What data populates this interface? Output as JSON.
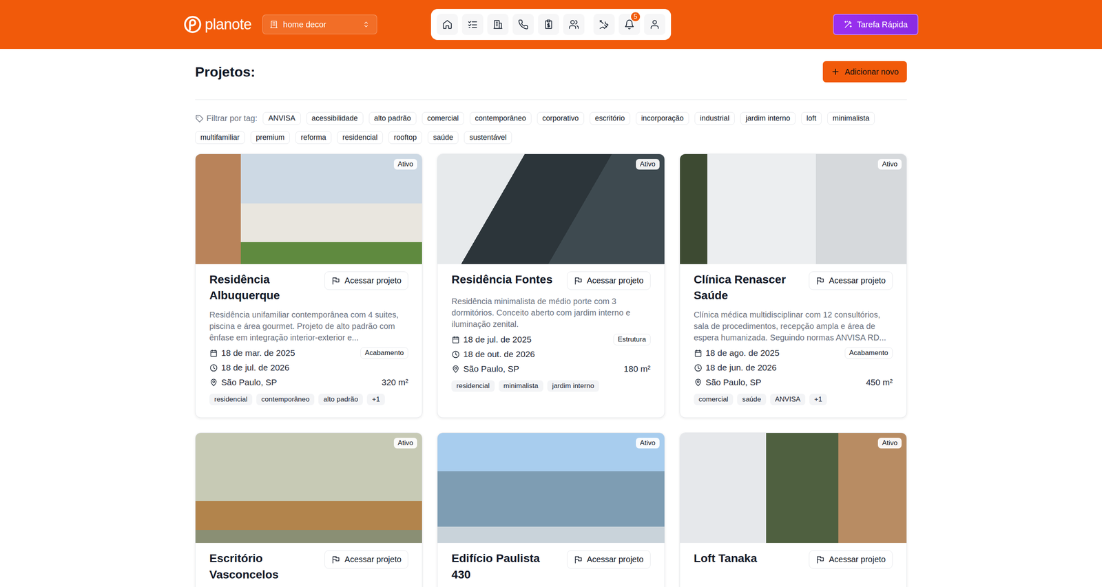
{
  "header": {
    "logo": "planote",
    "workspace": "home decor",
    "notifications": "5",
    "quick_task": "Tarefa Rápida"
  },
  "page": {
    "title": "Projetos:",
    "add_button": "Adicionar novo"
  },
  "filter": {
    "label": "Filtrar por tag:",
    "tags": [
      "ANVISA",
      "acessibilidade",
      "alto padrão",
      "comercial",
      "contemporâneo",
      "corporativo",
      "escritório",
      "incorporação",
      "industrial",
      "jardim interno",
      "loft",
      "minimalista",
      "multifamiliar",
      "premium",
      "reforma",
      "residencial",
      "rooftop",
      "saúde",
      "sustentável"
    ]
  },
  "projects": [
    {
      "status": "Ativo",
      "title": "Residência Albuquerque",
      "action": "Acessar projeto",
      "description": "Residência unifamiliar contemporânea com 4 suites, piscina e área gourmet. Projeto de alto padrão com ênfase em integração interior-exterior e...",
      "start": "18 de mar. de 2025",
      "end": "18 de jul. de 2026",
      "phase": "Acabamento",
      "location": "São Paulo, SP",
      "area": "320 m²",
      "tags": [
        "residencial",
        "contemporâneo",
        "alto padrão"
      ],
      "more": "+1"
    },
    {
      "status": "Ativo",
      "title": "Residência Fontes",
      "action": "Acessar projeto",
      "description": "Residência minimalista de médio porte com 3 dormitórios. Conceito aberto com jardim interno e iluminação zenital.",
      "start": "18 de jul. de 2025",
      "end": "18 de out. de 2026",
      "phase": "Estrutura",
      "location": "São Paulo, SP",
      "area": "180 m²",
      "tags": [
        "residencial",
        "minimalista",
        "jardim interno"
      ],
      "more": ""
    },
    {
      "status": "Ativo",
      "title": "Clínica Renascer Saúde",
      "action": "Acessar projeto",
      "description": "Clínica médica multidisciplinar com 12 consultórios, sala de procedimentos, recepção ampla e área de espera humanizada. Seguindo normas ANVISA RD...",
      "start": "18 de ago. de 2025",
      "end": "18 de jun. de 2026",
      "phase": "Acabamento",
      "location": "São Paulo, SP",
      "area": "450 m²",
      "tags": [
        "comercial",
        "saúde",
        "ANVISA"
      ],
      "more": "+1"
    },
    {
      "status": "Ativo",
      "title": "Escritório Vasconcelos",
      "action": "Acessar projeto"
    },
    {
      "status": "Ativo",
      "title": "Edifício Paulista 430",
      "action": "Acessar projeto"
    },
    {
      "status": "Ativo",
      "title": "Loft Tanaka",
      "action": "Acessar projeto"
    }
  ]
}
